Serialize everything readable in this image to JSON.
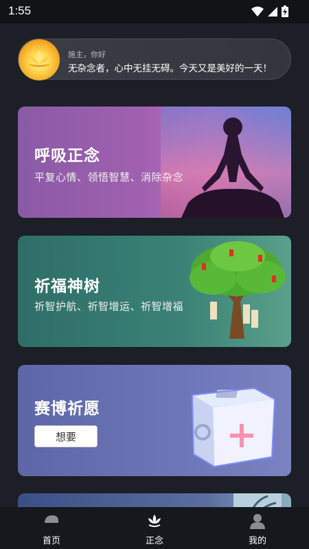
{
  "status_bar": {
    "time": "1:55"
  },
  "greeting": {
    "subtitle": "施主，你好",
    "message": "无杂念者，心中无挂无碍。今天又是美好的一天！"
  },
  "cards": [
    {
      "title": "呼吸正念",
      "desc": "平复心情、领悟智慧、消除杂念"
    },
    {
      "title": "祈福神树",
      "desc": "祈智护航、祈智增运、祈智增福"
    },
    {
      "title": "赛博祈愿",
      "button": "想要"
    }
  ],
  "nav": {
    "items": [
      {
        "label": "首页"
      },
      {
        "label": "正念"
      },
      {
        "label": "我的"
      }
    ]
  },
  "colors": {
    "background": "#1c1f26",
    "nav_bg": "#16181d",
    "card1": "#9a5fb0",
    "card2": "#2e6e67",
    "card3": "#5d67a8"
  }
}
